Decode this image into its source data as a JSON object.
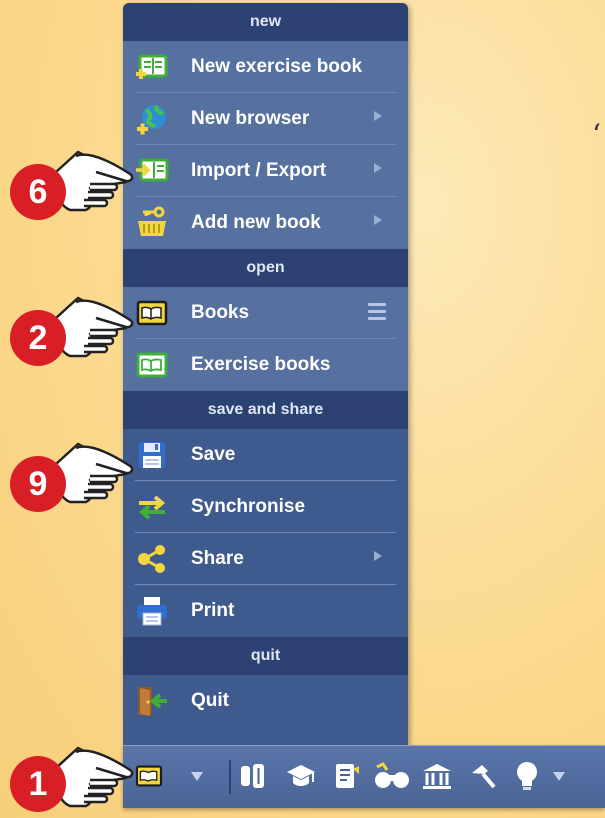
{
  "menu": {
    "sections": [
      {
        "header": "new",
        "items": [
          {
            "label": "New exercise book",
            "icon": "exercise-book-plus-icon",
            "submenu": false
          },
          {
            "label": "New browser",
            "icon": "globe-plus-icon",
            "submenu": true
          },
          {
            "label": "Import / Export",
            "icon": "import-export-book-icon",
            "submenu": true
          },
          {
            "label": "Add new book",
            "icon": "basket-key-icon",
            "submenu": true
          }
        ]
      },
      {
        "header": "open",
        "items": [
          {
            "label": "Books",
            "icon": "book-icon",
            "options": true
          },
          {
            "label": "Exercise books",
            "icon": "exercise-book-icon"
          }
        ]
      },
      {
        "header": "save and share",
        "items": [
          {
            "label": "Save",
            "icon": "floppy-disk-icon"
          },
          {
            "label": "Synchronise",
            "icon": "sync-arrows-icon"
          },
          {
            "label": "Share",
            "icon": "share-icon",
            "submenu": true
          },
          {
            "label": "Print",
            "icon": "printer-icon"
          }
        ]
      },
      {
        "header": "quit",
        "items": [
          {
            "label": "Quit",
            "icon": "exit-door-icon"
          }
        ]
      }
    ]
  },
  "toolbar": {
    "buttons": [
      "book-icon",
      "dropdown-icon",
      "columns-icon",
      "graduation-cap-icon",
      "notes-icon",
      "binoculars-icon",
      "library-icon",
      "hammer-icon",
      "lightbulb-icon",
      "dropdown-icon"
    ]
  },
  "callouts": {
    "import_export": "6",
    "books": "2",
    "save": "9",
    "toolbar": "1"
  },
  "quote_mark": "‘",
  "colors": {
    "menu_bg": "#3f5a8c",
    "header_bg": "#2c4272",
    "item_highlight": "#56709f",
    "badge": "#d91f26",
    "icon_green": "#3fae3a",
    "icon_yellow": "#f2d640"
  }
}
